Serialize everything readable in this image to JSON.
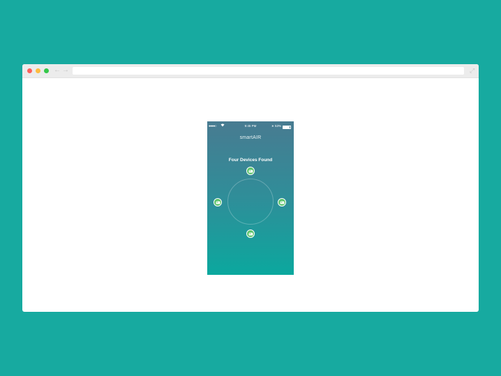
{
  "browser": {
    "back_icon": "arrow-left-icon",
    "forward_icon": "arrow-right-icon",
    "expand_icon": "expand-icon",
    "url": ""
  },
  "phone": {
    "status_bar": {
      "signal": "●●●●○",
      "time": "9:45 PM",
      "battery_percent": "53%"
    },
    "app_title": "smartAIR",
    "heading": "Four Devices Found",
    "devices": [
      {
        "icon": "air-purifier-icon"
      },
      {
        "icon": "air-purifier-icon"
      },
      {
        "icon": "air-purifier-icon"
      },
      {
        "icon": "air-purifier-icon"
      }
    ],
    "colors": {
      "gradient_top": "#487b91",
      "gradient_bottom": "#0ba89e",
      "device_badge": "#5bc36a"
    }
  },
  "colors": {
    "backdrop": "#17aaa0"
  }
}
